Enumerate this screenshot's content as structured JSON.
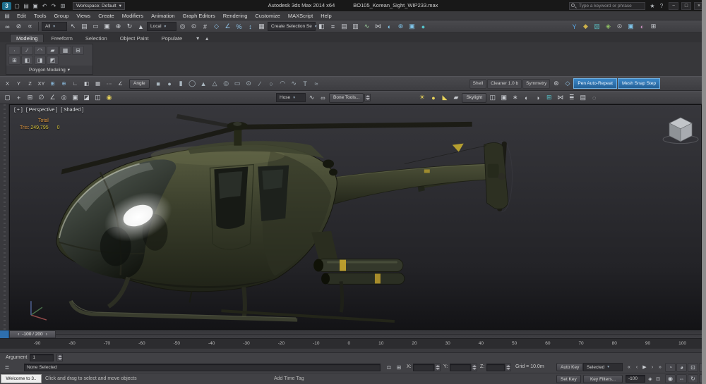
{
  "colors": {
    "accent_blue": "#2e6fae",
    "ui_background": "#414145",
    "viewport_top": "#37373c",
    "viewport_bottom": "#131316",
    "helicopter_olive": "#3c402c",
    "stats_orange": "#e0973f",
    "stats_yellow": "#d8c23a"
  },
  "titlebar": {
    "logo_glyph": "3",
    "app_title": "Autodesk 3ds Max 2014 x64",
    "file_name": "BO105_Korean_Sight_WIP233.max",
    "search_placeholder": "Type a keyword or phrase",
    "workspace_label": "Workspace: Default",
    "workspace_caret": "▾",
    "qat_icons": [
      {
        "name": "new-scene-icon",
        "glyph": "▢"
      },
      {
        "name": "open-file-icon",
        "glyph": "▤"
      },
      {
        "name": "save-file-icon",
        "glyph": "▣"
      },
      {
        "name": "undo-icon",
        "glyph": "↶"
      },
      {
        "name": "redo-icon",
        "glyph": "↷"
      },
      {
        "name": "project-folder-icon",
        "glyph": "⊞"
      }
    ],
    "right_icons": [
      {
        "name": "community-icon",
        "glyph": "★"
      },
      {
        "name": "help-icon",
        "glyph": "?"
      }
    ],
    "window_controls": {
      "minimize": "−",
      "maximize": "□",
      "close": "×"
    }
  },
  "menubar": {
    "explorer_glyph": "▤",
    "items": [
      {
        "name": "menu-edit",
        "label": "Edit"
      },
      {
        "name": "menu-tools",
        "label": "Tools"
      },
      {
        "name": "menu-group",
        "label": "Group"
      },
      {
        "name": "menu-views",
        "label": "Views"
      },
      {
        "name": "menu-create",
        "label": "Create"
      },
      {
        "name": "menu-modifiers",
        "label": "Modifiers"
      },
      {
        "name": "menu-animation",
        "label": "Animation"
      },
      {
        "name": "menu-graph-editors",
        "label": "Graph Editors"
      },
      {
        "name": "menu-rendering",
        "label": "Rendering"
      },
      {
        "name": "menu-customize",
        "label": "Customize"
      },
      {
        "name": "menu-maxscript",
        "label": "MAXScript"
      },
      {
        "name": "menu-help",
        "label": "Help"
      }
    ]
  },
  "main_toolbar": {
    "icons_link": [
      {
        "name": "select-and-link-icon",
        "glyph": "∞"
      },
      {
        "name": "unlink-selection-icon",
        "glyph": "⊘"
      },
      {
        "name": "bind-to-space-warp-icon",
        "glyph": "∝"
      }
    ],
    "filter_value": "All",
    "icons_select": [
      {
        "name": "select-object-icon",
        "glyph": "↖"
      },
      {
        "name": "select-by-name-icon",
        "glyph": "▤"
      },
      {
        "name": "selection-region-icon",
        "glyph": "▭"
      },
      {
        "name": "window-crossing-icon",
        "glyph": "▣"
      },
      {
        "name": "select-and-move-icon",
        "glyph": "⊕"
      },
      {
        "name": "select-and-rotate-icon",
        "glyph": "↻"
      },
      {
        "name": "select-and-scale-icon",
        "glyph": "▲"
      }
    ],
    "ref_coord_value": "Local",
    "icons_snap": [
      {
        "name": "use-pivot-center-icon",
        "glyph": "◎"
      },
      {
        "name": "select-and-manipulate-icon",
        "glyph": "⊙"
      },
      {
        "name": "keyboard-override-icon",
        "glyph": "#"
      },
      {
        "name": "snaps-toggle-icon",
        "glyph": "◇",
        "color": "#8fc3e8"
      },
      {
        "name": "angle-snap-icon",
        "glyph": "∠",
        "color": "#8fc3e8"
      },
      {
        "name": "percent-snap-icon",
        "glyph": "%",
        "color": "#8fc3e8"
      },
      {
        "name": "spinner-snap-icon",
        "glyph": "↕",
        "color": "#8fc3e8"
      },
      {
        "name": "edit-named-selections-icon",
        "glyph": "▦"
      }
    ],
    "named_sel_value": "Create Selection Se",
    "icons_tools": [
      {
        "name": "mirror-icon",
        "glyph": "◧"
      },
      {
        "name": "align-icon",
        "glyph": "≡"
      },
      {
        "name": "layer-explorer-icon",
        "glyph": "▤"
      },
      {
        "name": "ribbon-toggle-icon",
        "glyph": "▥"
      },
      {
        "name": "curve-editor-icon",
        "glyph": "∿",
        "color": "#9fd49f"
      },
      {
        "name": "schematic-view-icon",
        "glyph": "⋈"
      },
      {
        "name": "material-editor-icon",
        "glyph": "◐",
        "color": "#7fc4e8"
      },
      {
        "name": "render-setup-icon",
        "glyph": "⊛",
        "color": "#7fc4e8"
      },
      {
        "name": "rendered-frame-icon",
        "glyph": "▣",
        "color": "#7fc4e8"
      },
      {
        "name": "render-production-icon",
        "glyph": "●",
        "color": "#55c2c8"
      }
    ],
    "icons_right": [
      {
        "name": "y-constraint-icon",
        "glyph": "Y",
        "color": "#57a8e8"
      },
      {
        "name": "custom-tool-1-icon",
        "glyph": "◆",
        "color": "#cdb14a"
      },
      {
        "name": "custom-tool-2-icon",
        "glyph": "▧",
        "color": "#58b7ba"
      },
      {
        "name": "custom-tool-3-icon",
        "glyph": "◈",
        "color": "#8fc063"
      },
      {
        "name": "custom-tool-4-icon",
        "glyph": "⊙"
      },
      {
        "name": "custom-tool-5-icon",
        "glyph": "▣",
        "color": "#7fc4e8"
      },
      {
        "name": "custom-tool-6-icon",
        "glyph": "◐",
        "color": "#c98fbf"
      },
      {
        "name": "custom-tool-7-icon",
        "glyph": "⊞"
      }
    ]
  },
  "ribbon": {
    "tabs": [
      {
        "name": "tab-modeling",
        "label": "Modeling",
        "selected": true
      },
      {
        "name": "tab-freeform",
        "label": "Freeform"
      },
      {
        "name": "tab-selection",
        "label": "Selection"
      },
      {
        "name": "tab-object-paint",
        "label": "Object Paint"
      },
      {
        "name": "tab-populate",
        "label": "Populate"
      }
    ],
    "tab_icons": [
      {
        "name": "ribbon-options-icon",
        "glyph": "▾"
      },
      {
        "name": "ribbon-minimize-icon",
        "glyph": "▴"
      }
    ],
    "panel_label": "Polygon Modeling",
    "panel_caret": "▾",
    "panel_buttons": [
      {
        "name": "vertex-mode-icon",
        "glyph": "∙"
      },
      {
        "name": "edge-mode-icon",
        "glyph": "∕"
      },
      {
        "name": "border-mode-icon",
        "glyph": "◠"
      },
      {
        "name": "polygon-mode-icon",
        "glyph": "▰"
      },
      {
        "name": "element-mode-icon",
        "glyph": "▦"
      },
      {
        "name": "preview-subobj-icon",
        "glyph": "⊟"
      },
      {
        "name": "pin-stack-icon",
        "glyph": "⊞"
      },
      {
        "name": "collapse-stack-icon",
        "glyph": "◧"
      },
      {
        "name": "edit-poly-mode-icon",
        "glyph": "◨"
      },
      {
        "name": "modify-mode-icon",
        "glyph": "◩"
      }
    ]
  },
  "rowA": {
    "icons_axis": [
      {
        "name": "restrict-x-icon",
        "glyph": "X"
      },
      {
        "name": "restrict-y-icon",
        "glyph": "Y"
      },
      {
        "name": "restrict-z-icon",
        "glyph": "Z"
      },
      {
        "name": "restrict-plane-icon",
        "glyph": "XY"
      },
      {
        "name": "snap-grid-icon",
        "glyph": "⊞",
        "color": "#8fc3e8"
      },
      {
        "name": "polar-snap-icon",
        "glyph": "⊕",
        "color": "#8fc3e8"
      },
      {
        "name": "ortho-mode-icon",
        "glyph": "∟"
      },
      {
        "name": "mirror-axis-icon",
        "glyph": "◧"
      },
      {
        "name": "array-tool-icon",
        "glyph": "▦"
      },
      {
        "name": "spacing-tool-icon",
        "glyph": "⋯"
      },
      {
        "name": "measure-angle-icon",
        "glyph": "∠"
      }
    ],
    "angle_label": "Angle",
    "icons_primitives": [
      {
        "name": "box-primitive-icon",
        "glyph": "■"
      },
      {
        "name": "sphere-primitive-icon",
        "glyph": "●"
      },
      {
        "name": "cylinder-primitive-icon",
        "glyph": "▮"
      },
      {
        "name": "torus-primitive-icon",
        "glyph": "◯"
      },
      {
        "name": "cone-primitive-icon",
        "glyph": "▲"
      },
      {
        "name": "pyramid-primitive-icon",
        "glyph": "△"
      },
      {
        "name": "tube-primitive-icon",
        "glyph": "◎"
      },
      {
        "name": "plane-primitive-icon",
        "glyph": "▭"
      },
      {
        "name": "teapot-primitive-icon",
        "glyph": "⊙"
      },
      {
        "name": "line-shape-icon",
        "glyph": "∕"
      },
      {
        "name": "circle-shape-icon",
        "glyph": "○"
      },
      {
        "name": "arc-shape-icon",
        "glyph": "◠"
      },
      {
        "name": "spline-shape-icon",
        "glyph": "∿"
      },
      {
        "name": "text-shape-icon",
        "glyph": "T"
      },
      {
        "name": "helix-shape-icon",
        "glyph": "≈"
      }
    ],
    "shell_label": "Shell",
    "cleaner_label": "Cleaner 1.0 b",
    "symmetry_label": "Symmetry",
    "icons_extra": [
      {
        "name": "settings-gear-icon",
        "glyph": "⊛"
      },
      {
        "name": "snap-magnet-icon",
        "glyph": "◇",
        "color": "#8fc3e8"
      }
    ],
    "pen_autorepeat_label": "Pen Auto-Repeat",
    "mesh_snap_label": "Mesh Snap Step"
  },
  "rowB": {
    "icons_a": [
      {
        "name": "dummy-helper-icon",
        "glyph": "▢"
      },
      {
        "name": "point-helper-icon",
        "glyph": "+"
      },
      {
        "name": "grid-helper-icon",
        "glyph": "⊞"
      },
      {
        "name": "tape-helper-icon",
        "glyph": "∅"
      },
      {
        "name": "protractor-helper-icon",
        "glyph": "∠"
      },
      {
        "name": "compass-helper-icon",
        "glyph": "◎"
      },
      {
        "name": "container-icon",
        "glyph": "▣"
      },
      {
        "name": "proxy-object-icon",
        "glyph": "◪"
      },
      {
        "name": "assembly-icon",
        "glyph": "◫"
      },
      {
        "name": "light-lister-icon",
        "glyph": "◉",
        "color": "#e8d35a"
      }
    ],
    "hose_value": "Hose",
    "icons_b": [
      {
        "name": "spline-ik-icon",
        "glyph": "∿"
      },
      {
        "name": "parameter-wire-icon",
        "glyph": "∞"
      }
    ],
    "bone_tools_label": "Bone Tools...",
    "icons_lights": [
      {
        "name": "daylight-icon",
        "glyph": "☀",
        "color": "#e8d35a"
      },
      {
        "name": "omni-light-icon",
        "glyph": "●",
        "color": "#e8d35a"
      },
      {
        "name": "spot-light-icon",
        "glyph": "◣",
        "color": "#e8d35a"
      },
      {
        "name": "area-light-icon",
        "glyph": "▰",
        "color": "#c9ccd1"
      }
    ],
    "skylight_label": "Skylight",
    "icons_right": [
      {
        "name": "camera-icon",
        "glyph": "◫"
      },
      {
        "name": "target-camera-icon",
        "glyph": "▣"
      },
      {
        "name": "effects-icon",
        "glyph": "∗"
      },
      {
        "name": "environment-icon",
        "glyph": "◐"
      },
      {
        "name": "exposure-control-icon",
        "glyph": "◑"
      },
      {
        "name": "batch-render-icon",
        "glyph": "⊞",
        "color": "#55c2c8"
      },
      {
        "name": "video-post-icon",
        "glyph": "⋈"
      },
      {
        "name": "state-sets-icon",
        "glyph": "≣"
      },
      {
        "name": "scene-explorer-icon",
        "glyph": "▤"
      },
      {
        "name": "isolate-selection-icon",
        "glyph": "◌"
      }
    ]
  },
  "viewport": {
    "label_segments": [
      {
        "name": "viewport-general-menu",
        "label": "[ + ]"
      },
      {
        "name": "viewport-pov-menu",
        "label": "[ Perspective ]"
      },
      {
        "name": "viewport-shading-menu",
        "label": "[ Shaded ]"
      }
    ],
    "stats": {
      "total_label": "Total",
      "tris_label": "Tris:",
      "tris_value": "249,795",
      "extra_value": "0"
    }
  },
  "timeline": {
    "handle_prev": "‹",
    "handle_value": "-100 / 200",
    "handle_next": "›"
  },
  "trackbar": {
    "numbers": [
      "-90",
      "-80",
      "-70",
      "-60",
      "-50",
      "-40",
      "-30",
      "-20",
      "-10",
      "0",
      "10",
      "20",
      "30",
      "40",
      "50",
      "60",
      "70",
      "80",
      "90",
      "100"
    ]
  },
  "argument": {
    "label": "Argument",
    "value": "1"
  },
  "status": {
    "none_selected": "None Selected",
    "lock_glyph": "◘",
    "absolute_mode_glyph": "⊞",
    "x_label": "X:",
    "y_label": "Y:",
    "z_label": "Z:",
    "grid_label": "Grid = 10.0m",
    "autokey_label": "Auto Key",
    "selected_value": "Selected",
    "setkey_label": "Set Key",
    "keyfilters_label": "Key Filters...",
    "add_time_tag": "Add Time Tag",
    "welcome_label": "Welcome to 3..",
    "prompt": "Click and drag to select and move objects",
    "frame_value": "-100",
    "playback_row1": [
      {
        "name": "go-to-start-icon",
        "glyph": "«"
      },
      {
        "name": "previous-frame-icon",
        "glyph": "‹"
      },
      {
        "name": "play-animation-icon",
        "glyph": "▶"
      },
      {
        "name": "next-frame-icon",
        "glyph": "›"
      },
      {
        "name": "go-to-end-icon",
        "glyph": "»"
      }
    ],
    "playback_row2": [
      {
        "name": "key-mode-toggle-icon",
        "glyph": "◈"
      },
      {
        "name": "time-configuration-icon",
        "glyph": "⊡"
      }
    ],
    "nav_icons_row1": [
      {
        "name": "zoom-icon",
        "glyph": "◔"
      },
      {
        "name": "zoom-all-icon",
        "glyph": "◕"
      },
      {
        "name": "zoom-extents-icon",
        "glyph": "⊡"
      },
      {
        "name": "zoom-extents-all-icon",
        "glyph": "⊞"
      }
    ],
    "nav_icons_row2": [
      {
        "name": "field-of-view-icon",
        "glyph": "◉"
      },
      {
        "name": "pan-view-icon",
        "glyph": "⇔"
      },
      {
        "name": "orbit-view-icon",
        "glyph": "↻"
      },
      {
        "name": "maximize-viewport-icon",
        "glyph": "⊠"
      }
    ]
  }
}
